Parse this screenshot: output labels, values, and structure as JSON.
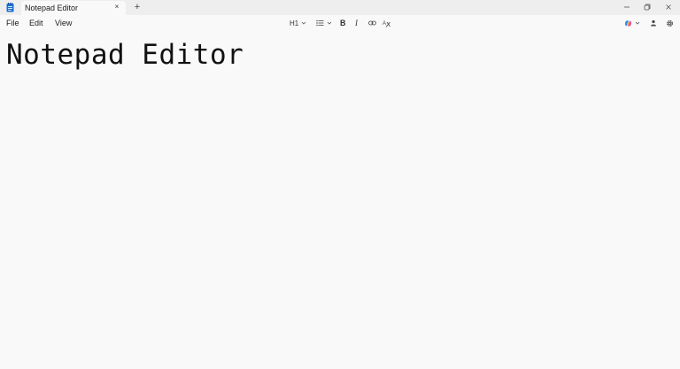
{
  "window": {
    "tab_title": "Notepad Editor",
    "tab_close_glyph": "×",
    "new_tab_glyph": "+"
  },
  "menu": {
    "file": "File",
    "edit": "Edit",
    "view": "View"
  },
  "toolbar": {
    "heading_label": "H1",
    "bold_label": "B",
    "italic_label": "I"
  },
  "document": {
    "heading": "Notepad Editor"
  },
  "icons": {
    "app": "notepad-icon",
    "list": "bulleted-list-icon",
    "link": "link-icon",
    "clear_formatting": "clear-formatting-icon",
    "copilot": "copilot-icon",
    "account": "account-icon",
    "settings": "gear-icon",
    "minimize": "minimize-icon",
    "maximize": "restore-icon",
    "close": "close-icon"
  },
  "colors": {
    "background": "#f9f9f9",
    "titlebar": "#eeeeee",
    "app_icon": "#1b6fd0",
    "text": "#1a1a1a"
  }
}
